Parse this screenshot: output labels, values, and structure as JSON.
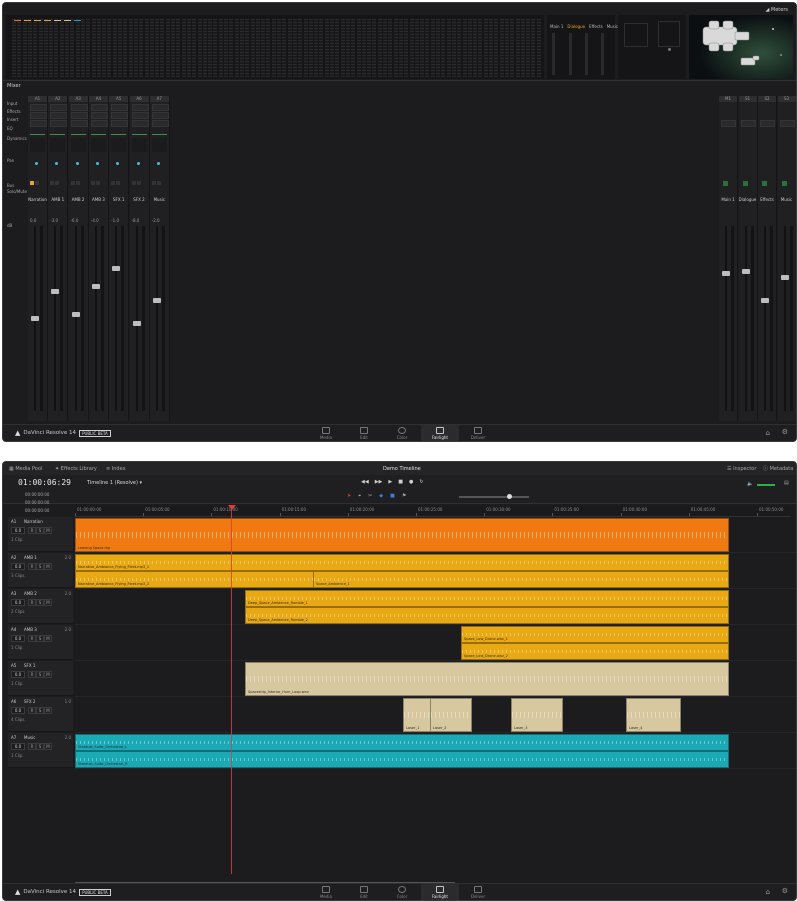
{
  "app": {
    "name": "DaVinci Resolve 14",
    "badge": "PUBLIC BETA",
    "nav": [
      "Media",
      "Edit",
      "Color",
      "Fairlight",
      "Deliver"
    ],
    "active_page": "Fairlight"
  },
  "mixer": {
    "header_right": "Meters",
    "bus_labels": [
      "Main 1",
      "Dialogue",
      "Effects",
      "Music"
    ],
    "section_label": "Mixer",
    "row_labels": [
      "Input",
      "Effects",
      "Insert",
      "EQ",
      "Dynamics",
      "Pan",
      "Bus",
      "Solo/Mute"
    ],
    "channels": [
      "A1",
      "A2",
      "A3",
      "A4",
      "A5",
      "A6",
      "A7"
    ],
    "channel_names": [
      "Narration",
      "AMB 1",
      "AMB 2",
      "AMB 3",
      "SFX 1",
      "SFX 2",
      "Music"
    ],
    "channel_gains": [
      "0.0",
      "-3.0",
      "-6.0",
      "-4.0",
      "-1.0",
      "-8.0",
      "-2.0"
    ],
    "bus_channels": [
      "M1",
      "S1",
      "S2",
      "S3"
    ],
    "bus_names": [
      "Main 1",
      "Dialogue",
      "Effects",
      "Music"
    ],
    "gain_label": "dB",
    "accent_colors": [
      "#e07a2b",
      "#e0a72b",
      "#d5c391",
      "#1ea7b5"
    ]
  },
  "timeline": {
    "topbar": {
      "media_pool": "Media Pool",
      "effects_library": "Effects Library",
      "index": "Index",
      "title": "Demo Timeline",
      "inspector": "Inspector",
      "metadata": "Metadata"
    },
    "timecode": "01:00:06:29",
    "timeline_name": "Timeline 1 (Resolve)",
    "sub_timecodes": [
      "00:00:00:00",
      "00:00:00:00",
      "00:00:00:00"
    ],
    "ruler": [
      "01:00:00:00",
      "01:00:05:00",
      "01:00:10:00",
      "01:00:15:00",
      "01:00:20:00",
      "01:00:25:00",
      "01:00:30:00",
      "01:00:35:00",
      "01:00:40:00",
      "01:00:45:00",
      "01:00:50:00",
      "01:00:55:00"
    ],
    "tracks": [
      {
        "id": "A1",
        "name": "Narration",
        "gain": "0.0",
        "clips_count": "1 Clip",
        "ch": ""
      },
      {
        "id": "A2",
        "name": "AMB 1",
        "gain": "0.0",
        "clips_count": "3 Clips",
        "ch": "2.0"
      },
      {
        "id": "A3",
        "name": "AMB 2",
        "gain": "0.0",
        "clips_count": "2 Clips",
        "ch": "2.0"
      },
      {
        "id": "A4",
        "name": "AMB 3",
        "gain": "0.0",
        "clips_count": "1 Clip",
        "ch": "2.0"
      },
      {
        "id": "A5",
        "name": "SFX 1",
        "gain": "0.0",
        "clips_count": "1 Clip",
        "ch": ""
      },
      {
        "id": "A6",
        "name": "SFX 2",
        "gain": "0.0",
        "clips_count": "4 Clips",
        "ch": "1.0"
      },
      {
        "id": "A7",
        "name": "Music",
        "gain": "0.0",
        "clips_count": "1 Clip",
        "ch": "2.0"
      }
    ],
    "track_buttons": [
      "R",
      "S",
      "M"
    ],
    "clip_labels": {
      "narration": "Leaving Space.mp",
      "amb1_a": "Narrative_Ambiance_Flying_Fleet.mp3_1",
      "amb1_b": "Narrative_Ambiance_Flying_Fleet.mp3_2",
      "amb1_c": "Space_Ambience_1",
      "amb2_a": "Deep_Space_Ambience_Rumble_1",
      "amb2_b": "Deep_Space_Ambience_Rumble_2",
      "amb3_a": "Space_Low_Drone.wav_1",
      "amb3_b": "Space_Low_Drone.wav_2",
      "sfx1": "Spaceship_Interior_Hum_Loop.wav",
      "sfx2_a": "Laser_1",
      "sfx2_b": "Laser_2",
      "sfx2_c": "Laser_3",
      "sfx2_d": "Laser_4",
      "music_a": "Stardust_Suite_Orchestral_L",
      "music_b": "Stardust_Suite_Orchestral_R"
    },
    "colors": {
      "narration": "#ef7a12",
      "amb": "#e9a915",
      "sfx": "#d7c8a0",
      "music": "#1ba9b6",
      "playhead": "#e23b3b"
    }
  }
}
